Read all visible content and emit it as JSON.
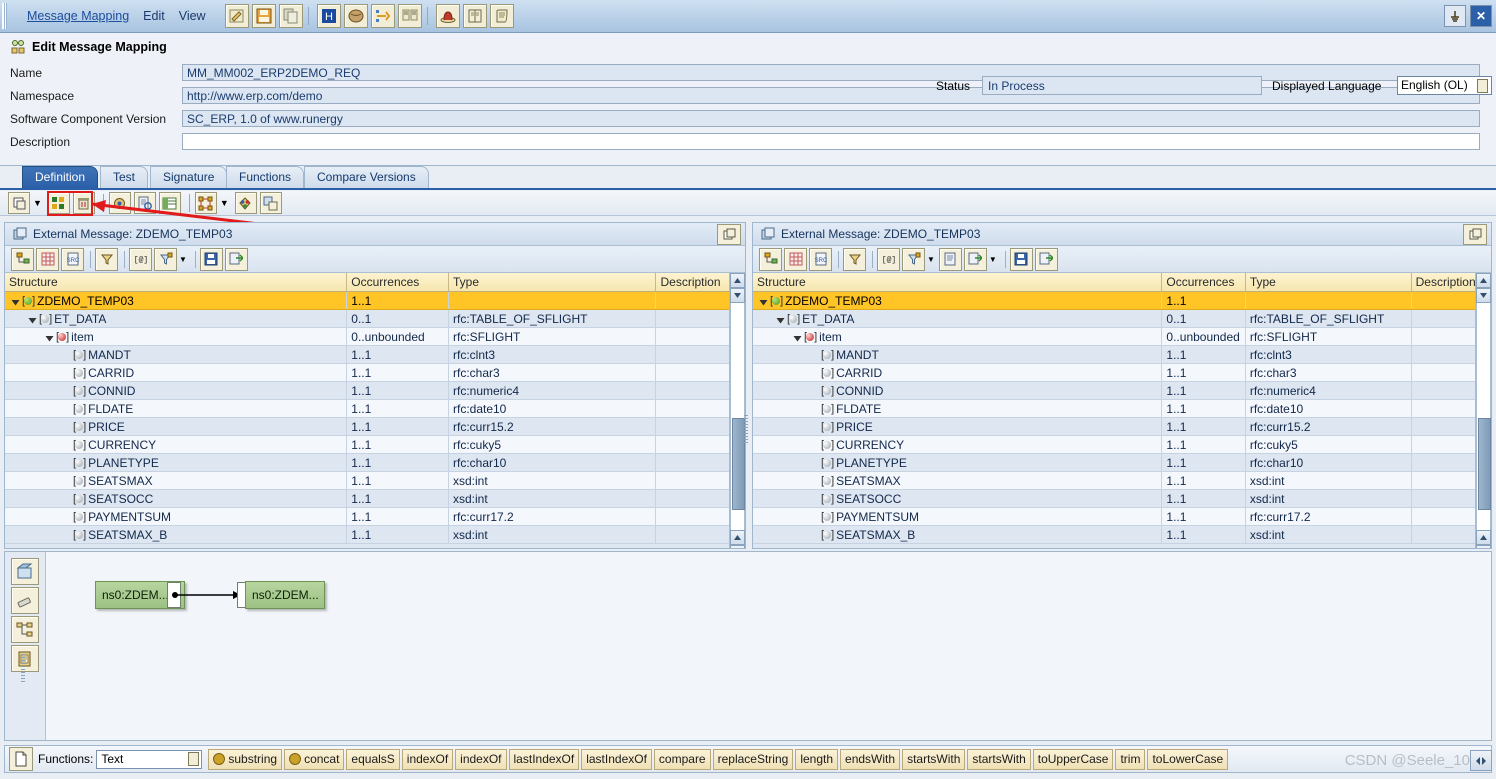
{
  "menubar": {
    "items": [
      "Message Mapping",
      "Edit",
      "View"
    ],
    "icons": [
      "edit-pencil-icon",
      "save-icon",
      "copy-icon",
      "history-icon",
      "object-icon",
      "where-used-icon",
      "compare-icon",
      "hat-icon",
      "book-icon",
      "scroll-icon"
    ],
    "window": [
      "pin-button",
      "close-button"
    ]
  },
  "header": {
    "title": "Edit Message Mapping",
    "fields": [
      {
        "label": "Name",
        "value": "MM_MM002_ERP2DEMO_REQ",
        "empty": false
      },
      {
        "label": "Namespace",
        "value": "http://www.erp.com/demo",
        "empty": false
      },
      {
        "label": "Software Component Version",
        "value": "SC_ERP, 1.0 of www.runergy",
        "empty": false
      },
      {
        "label": "Description",
        "value": "",
        "empty": true
      }
    ],
    "status_label": "Status",
    "status_value": "In Process",
    "language_label": "Displayed Language",
    "language_value": "English (OL)"
  },
  "tabs": [
    {
      "label": "Definition",
      "active": true
    },
    {
      "label": "Test",
      "active": false
    },
    {
      "label": "Signature",
      "active": false
    },
    {
      "label": "Functions",
      "active": false
    },
    {
      "label": "Compare Versions",
      "active": false
    }
  ],
  "definition_toolbar": {
    "buttons": [
      "layout-icon",
      "dropdown-arrow-icon",
      "grid-view-icon",
      "delete-icon",
      "settings-icon",
      "document-check-icon",
      "table-view-icon",
      "dependencies-icon",
      "dependencies-dropdown-icon",
      "color-palette-icon",
      "copy-mapping-icon"
    ]
  },
  "panels": {
    "columns": [
      "Structure",
      "Occurrences",
      "Type",
      "Description"
    ],
    "toolbar_icons": [
      "expand-tree-icon",
      "grid-icon",
      "source-icon",
      "filter-icon",
      "namespace-icon",
      "filter-dropdown-icon",
      "find-icon",
      "export-icon"
    ],
    "right_toolbar_icons": [
      "expand-tree-icon",
      "grid-icon",
      "source-icon",
      "filter-icon",
      "namespace-icon",
      "filter-dropdown-icon",
      "document-icon",
      "export-doc-icon",
      "find-icon",
      "export-icon"
    ],
    "left": {
      "title": "External Message: ZDEMO_TEMP03",
      "rows": [
        {
          "indent": 0,
          "name": "ZDEMO_TEMP03",
          "occurrences": "1..1",
          "type": "",
          "description": "",
          "icon": "green",
          "twisty": true,
          "selected": true
        },
        {
          "indent": 1,
          "name": "ET_DATA",
          "occurrences": "0..1",
          "type": "rfc:TABLE_OF_SFLIGHT",
          "description": "",
          "icon": "silver",
          "twisty": true,
          "selected": false
        },
        {
          "indent": 2,
          "name": "item",
          "occurrences": "0..unbounded",
          "type": "rfc:SFLIGHT",
          "description": "",
          "icon": "red",
          "twisty": true,
          "selected": false
        },
        {
          "indent": 3,
          "name": "MANDT",
          "occurrences": "1..1",
          "type": "rfc:clnt3",
          "description": "",
          "icon": "silver",
          "twisty": false,
          "selected": false
        },
        {
          "indent": 3,
          "name": "CARRID",
          "occurrences": "1..1",
          "type": "rfc:char3",
          "description": "",
          "icon": "silver",
          "twisty": false,
          "selected": false
        },
        {
          "indent": 3,
          "name": "CONNID",
          "occurrences": "1..1",
          "type": "rfc:numeric4",
          "description": "",
          "icon": "silver",
          "twisty": false,
          "selected": false
        },
        {
          "indent": 3,
          "name": "FLDATE",
          "occurrences": "1..1",
          "type": "rfc:date10",
          "description": "",
          "icon": "silver",
          "twisty": false,
          "selected": false
        },
        {
          "indent": 3,
          "name": "PRICE",
          "occurrences": "1..1",
          "type": "rfc:curr15.2",
          "description": "",
          "icon": "silver",
          "twisty": false,
          "selected": false
        },
        {
          "indent": 3,
          "name": "CURRENCY",
          "occurrences": "1..1",
          "type": "rfc:cuky5",
          "description": "",
          "icon": "silver",
          "twisty": false,
          "selected": false
        },
        {
          "indent": 3,
          "name": "PLANETYPE",
          "occurrences": "1..1",
          "type": "rfc:char10",
          "description": "",
          "icon": "silver",
          "twisty": false,
          "selected": false
        },
        {
          "indent": 3,
          "name": "SEATSMAX",
          "occurrences": "1..1",
          "type": "xsd:int",
          "description": "",
          "icon": "silver",
          "twisty": false,
          "selected": false
        },
        {
          "indent": 3,
          "name": "SEATSOCC",
          "occurrences": "1..1",
          "type": "xsd:int",
          "description": "",
          "icon": "silver",
          "twisty": false,
          "selected": false
        },
        {
          "indent": 3,
          "name": "PAYMENTSUM",
          "occurrences": "1..1",
          "type": "rfc:curr17.2",
          "description": "",
          "icon": "silver",
          "twisty": false,
          "selected": false
        },
        {
          "indent": 3,
          "name": "SEATSMAX_B",
          "occurrences": "1..1",
          "type": "xsd:int",
          "description": "",
          "icon": "silver",
          "twisty": false,
          "selected": false
        }
      ]
    },
    "right": {
      "title": "External Message: ZDEMO_TEMP03",
      "rows": [
        {
          "indent": 0,
          "name": "ZDEMO_TEMP03",
          "occurrences": "1..1",
          "type": "",
          "description": "",
          "icon": "green",
          "twisty": true,
          "selected": true
        },
        {
          "indent": 1,
          "name": "ET_DATA",
          "occurrences": "0..1",
          "type": "rfc:TABLE_OF_SFLIGHT",
          "description": "",
          "icon": "silver",
          "twisty": true,
          "selected": false
        },
        {
          "indent": 2,
          "name": "item",
          "occurrences": "0..unbounded",
          "type": "rfc:SFLIGHT",
          "description": "",
          "icon": "red",
          "twisty": true,
          "selected": false
        },
        {
          "indent": 3,
          "name": "MANDT",
          "occurrences": "1..1",
          "type": "rfc:clnt3",
          "description": "",
          "icon": "silver",
          "twisty": false,
          "selected": false
        },
        {
          "indent": 3,
          "name": "CARRID",
          "occurrences": "1..1",
          "type": "rfc:char3",
          "description": "",
          "icon": "silver",
          "twisty": false,
          "selected": false
        },
        {
          "indent": 3,
          "name": "CONNID",
          "occurrences": "1..1",
          "type": "rfc:numeric4",
          "description": "",
          "icon": "silver",
          "twisty": false,
          "selected": false
        },
        {
          "indent": 3,
          "name": "FLDATE",
          "occurrences": "1..1",
          "type": "rfc:date10",
          "description": "",
          "icon": "silver",
          "twisty": false,
          "selected": false
        },
        {
          "indent": 3,
          "name": "PRICE",
          "occurrences": "1..1",
          "type": "rfc:curr15.2",
          "description": "",
          "icon": "silver",
          "twisty": false,
          "selected": false
        },
        {
          "indent": 3,
          "name": "CURRENCY",
          "occurrences": "1..1",
          "type": "rfc:cuky5",
          "description": "",
          "icon": "silver",
          "twisty": false,
          "selected": false
        },
        {
          "indent": 3,
          "name": "PLANETYPE",
          "occurrences": "1..1",
          "type": "rfc:char10",
          "description": "",
          "icon": "silver",
          "twisty": false,
          "selected": false
        },
        {
          "indent": 3,
          "name": "SEATSMAX",
          "occurrences": "1..1",
          "type": "xsd:int",
          "description": "",
          "icon": "silver",
          "twisty": false,
          "selected": false
        },
        {
          "indent": 3,
          "name": "SEATSOCC",
          "occurrences": "1..1",
          "type": "xsd:int",
          "description": "",
          "icon": "silver",
          "twisty": false,
          "selected": false
        },
        {
          "indent": 3,
          "name": "PAYMENTSUM",
          "occurrences": "1..1",
          "type": "rfc:curr17.2",
          "description": "",
          "icon": "silver",
          "twisty": false,
          "selected": false
        },
        {
          "indent": 3,
          "name": "SEATSMAX_B",
          "occurrences": "1..1",
          "type": "xsd:int",
          "description": "",
          "icon": "silver",
          "twisty": false,
          "selected": false
        }
      ]
    }
  },
  "canvas": {
    "rail_buttons": [
      "pan-tool-icon",
      "eraser-icon",
      "layout-graph-icon",
      "clipboard-icon"
    ],
    "nodes": [
      {
        "label": "ns0:ZDEM..."
      },
      {
        "label": "ns0:ZDEM..."
      }
    ]
  },
  "functions_bar": {
    "doc_icon": "new-document-icon",
    "label": "Functions:",
    "selected_category": "Text",
    "buttons": [
      {
        "label": "substring",
        "gear": true
      },
      {
        "label": "concat",
        "gear": true
      },
      {
        "label": "equalsS",
        "gear": false
      },
      {
        "label": "indexOf",
        "gear": false
      },
      {
        "label": "indexOf",
        "gear": false
      },
      {
        "label": "lastIndexOf",
        "gear": false
      },
      {
        "label": "lastIndexOf",
        "gear": false
      },
      {
        "label": "compare",
        "gear": false
      },
      {
        "label": "replaceString",
        "gear": false
      },
      {
        "label": "length",
        "gear": false
      },
      {
        "label": "endsWith",
        "gear": false
      },
      {
        "label": "startsWith",
        "gear": false
      },
      {
        "label": "startsWith",
        "gear": false
      },
      {
        "label": "toUpperCase",
        "gear": false
      },
      {
        "label": "trim",
        "gear": false
      },
      {
        "label": "toLowerCase",
        "gear": false
      }
    ]
  },
  "watermark": "CSDN @Seele_10",
  "colors": {
    "selection": "#ffc426",
    "accent": "#2b5fa8",
    "annotation": "#e11b1b"
  }
}
